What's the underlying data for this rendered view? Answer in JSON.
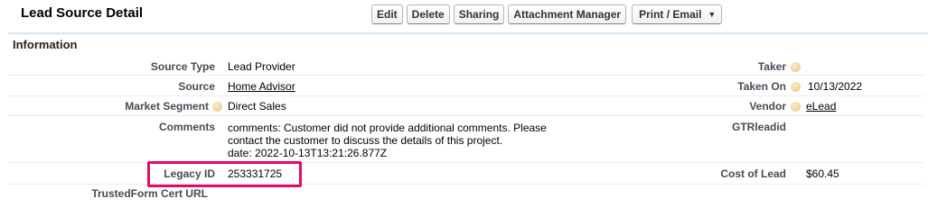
{
  "header": {
    "title": "Lead Source Detail",
    "buttons": {
      "edit": "Edit",
      "delete": "Delete",
      "sharing": "Sharing",
      "attachment_manager": "Attachment Manager",
      "print_email": "Print / Email"
    }
  },
  "section": {
    "title": "Information"
  },
  "fields": {
    "source_type": {
      "label": "Source Type",
      "value": "Lead Provider"
    },
    "source": {
      "label": "Source",
      "value": "Home Advisor"
    },
    "market_segment": {
      "label": "Market Segment",
      "value": "Direct Sales"
    },
    "comments": {
      "label": "Comments",
      "line1": "comments: Customer did not provide additional comments. Please",
      "line2": "contact the customer to discuss the details of this project.",
      "line3": "date: 2022-10-13T13:21:26.877Z"
    },
    "legacy_id": {
      "label": "Legacy ID",
      "value": "253331725"
    },
    "trustedform": {
      "label": "TrustedForm Cert URL",
      "value": ""
    },
    "taker": {
      "label": "Taker",
      "value": ""
    },
    "taken_on": {
      "label": "Taken On",
      "value": "10/13/2022"
    },
    "vendor": {
      "label": "Vendor",
      "value": "eLead"
    },
    "gtrleadid": {
      "label": "GTRleadid",
      "value": ""
    },
    "cost_of_lead": {
      "label": "Cost of Lead",
      "value": "$60.45"
    }
  },
  "highlight_color": "#e4096a",
  "icons": {
    "help": "help-bubble-icon",
    "caret": "chevron-down-icon"
  }
}
